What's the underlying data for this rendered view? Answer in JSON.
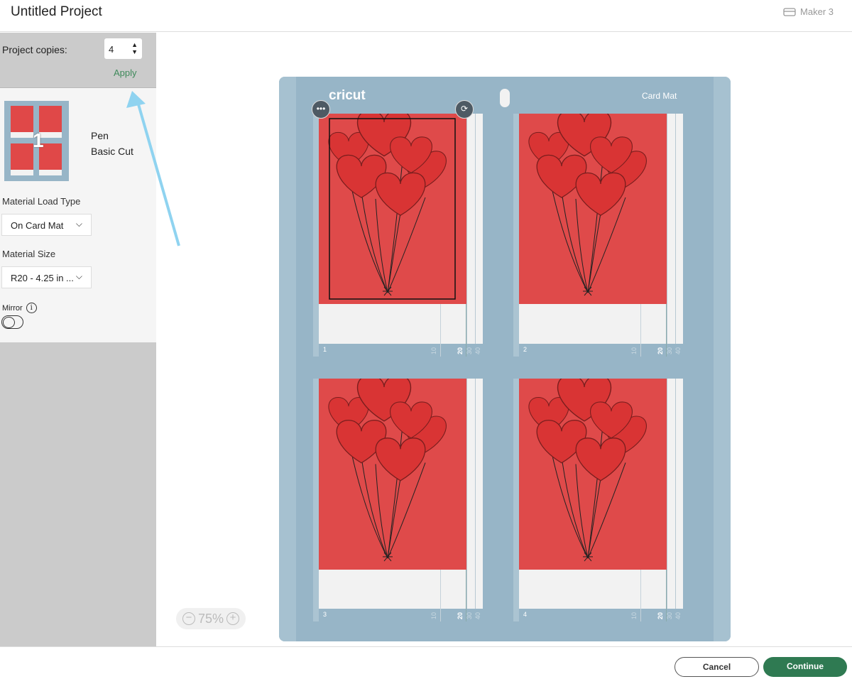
{
  "header": {
    "title": "Untitled Project",
    "machine": "Maker 3",
    "machine_icon": "printer-icon"
  },
  "copies": {
    "label": "Project copies:",
    "value": "4",
    "apply": "Apply"
  },
  "mat_summary": {
    "number": "1",
    "tool": "Pen",
    "cut": "Basic Cut"
  },
  "material_load": {
    "label": "Material Load Type",
    "value": "On Card Mat"
  },
  "material_size": {
    "label": "Material Size",
    "value": "R20 - 4.25 in ..."
  },
  "mirror": {
    "label": "Mirror",
    "on": false
  },
  "mat": {
    "brand": "cricut",
    "name": "Card Mat",
    "cards": [
      "1",
      "2",
      "3",
      "4"
    ],
    "ticks": [
      "10",
      "20",
      "30",
      "40"
    ]
  },
  "zoom": {
    "value": "75%"
  },
  "footer": {
    "cancel": "Cancel",
    "continue": "Continue"
  },
  "colors": {
    "accent": "#2f7a52",
    "mat": "#97b5c7",
    "card": "#df4a4a",
    "arrow": "#8fd3f0"
  }
}
